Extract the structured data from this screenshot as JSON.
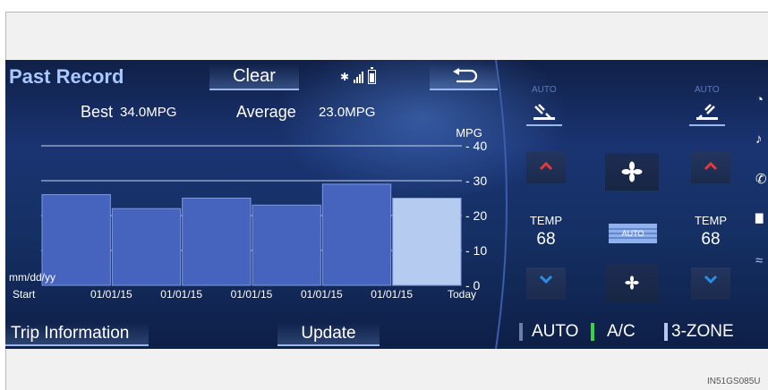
{
  "header": {
    "title": "Past Record",
    "clear_label": "Clear"
  },
  "stats": {
    "best_label": "Best",
    "best_value": "34.0MPG",
    "average_label": "Average",
    "average_value": "23.0MPG"
  },
  "chart_data": {
    "type": "bar",
    "unit_label": "MPG",
    "date_label": "mm/dd/yy",
    "categories": [
      "Start",
      "01/01/15",
      "01/01/15",
      "01/01/15",
      "01/01/15",
      "01/01/15",
      "Today"
    ],
    "values": [
      26,
      22,
      25,
      23,
      29,
      25
    ],
    "highlight_last": true,
    "ylim": [
      0,
      40
    ],
    "yticks": [
      0,
      10,
      20,
      30,
      40
    ],
    "grid": true,
    "colors": {
      "bar": "#4664bd",
      "bar_current": "#b5cbef",
      "bar_border": "#7e98e0"
    }
  },
  "bottom": {
    "trip_label": "Trip Information",
    "update_label": "Update"
  },
  "climate": {
    "auto_small": "AUTO",
    "left_temp_label": "TEMP",
    "left_temp_value": "68",
    "right_temp_label": "TEMP",
    "right_temp_value": "68",
    "fan_auto_label": "AUTO",
    "auto_btn": "AUTO",
    "ac_btn": "A/C",
    "zone_btn": "3-ZONE",
    "colors": {
      "up_arrow": "#e23a3a",
      "down_arrow": "#2d8de0",
      "ac_indicator": "#3bd14b",
      "zone_indicator": "#b6c7f0"
    }
  },
  "side_icons": [
    "gauge-icon",
    "music-icon",
    "phone-icon",
    "chart-icon",
    "climate-icon"
  ],
  "image_code": "IN51GS085U"
}
